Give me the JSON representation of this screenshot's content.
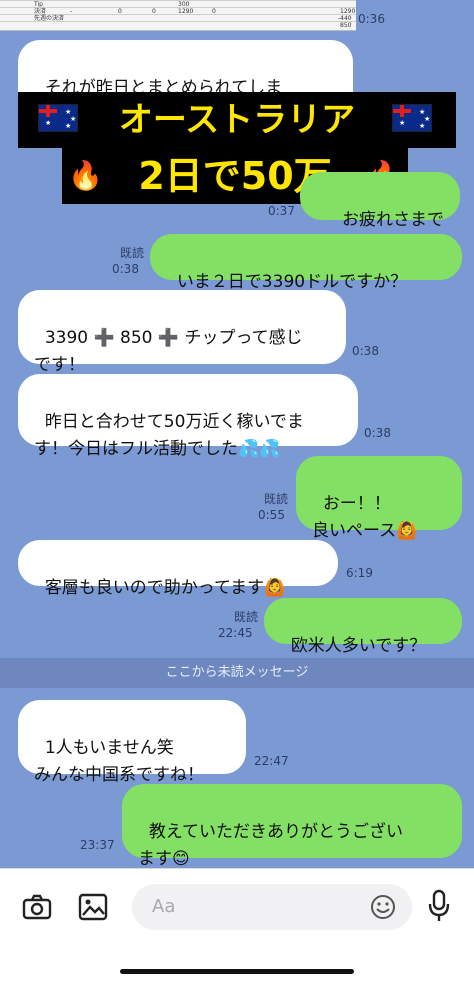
{
  "spreadsheet": {
    "rows": [
      {
        "label": "Tip",
        "values": [
          "",
          "",
          "",
          "300",
          "",
          ""
        ]
      },
      {
        "label": "決済",
        "values": [
          "-",
          "0",
          "0",
          "1290",
          "0",
          "1290"
        ]
      },
      {
        "label": "先週の決済",
        "values": [
          "",
          "",
          "",
          "",
          "",
          "-440"
        ]
      },
      {
        "label": "",
        "values": [
          "",
          "",
          "",
          "",
          "",
          "850"
        ]
      }
    ]
  },
  "overlay": {
    "line1": "オーストラリア",
    "line2": "2日で50万"
  },
  "messages": [
    {
      "side": "left",
      "text": "それが昨日とまとめられてしま\nい、今日は振込のお客様も多数い",
      "time": "0:36"
    },
    {
      "side": "right",
      "text": "お疲れさまです！",
      "read": "",
      "time": "0:37"
    },
    {
      "side": "right",
      "text": "いま２日で3390ドルですか？",
      "read": "既読",
      "time": "0:38"
    },
    {
      "side": "left",
      "text": "3390 ➕ 850 ➕ チップって感じ\nです！",
      "time": "0:38"
    },
    {
      "side": "left",
      "text": "昨日と合わせて50万近く稼いでま\nす！今日はフル活動でした💦💦",
      "time": "0:38"
    },
    {
      "side": "right",
      "text": "おー！！\n良いペース🙆",
      "read": "既読",
      "time": "0:55"
    },
    {
      "side": "left",
      "text": "客層も良いので助かってます🙆",
      "time": "6:19"
    },
    {
      "side": "right",
      "text": "欧米人多いです？",
      "read": "既読",
      "time": "22:45"
    },
    {
      "side": "left",
      "text": "1人もいません笑\nみんな中国系ですね！",
      "time": "22:47"
    },
    {
      "side": "right",
      "text": "教えていただきありがとうござい\nます😊",
      "read": "",
      "time": "23:37"
    }
  ],
  "unread_divider": "ここから未読メッセージ",
  "composer": {
    "placeholder": "Aa",
    "icons": [
      "camera-icon",
      "image-icon",
      "emoji-icon",
      "microphone-icon"
    ]
  },
  "colors": {
    "background": "#7b9ad3",
    "sent_bubble": "#84e064",
    "received_bubble": "#ffffff",
    "banner_text": "#ffe600"
  }
}
